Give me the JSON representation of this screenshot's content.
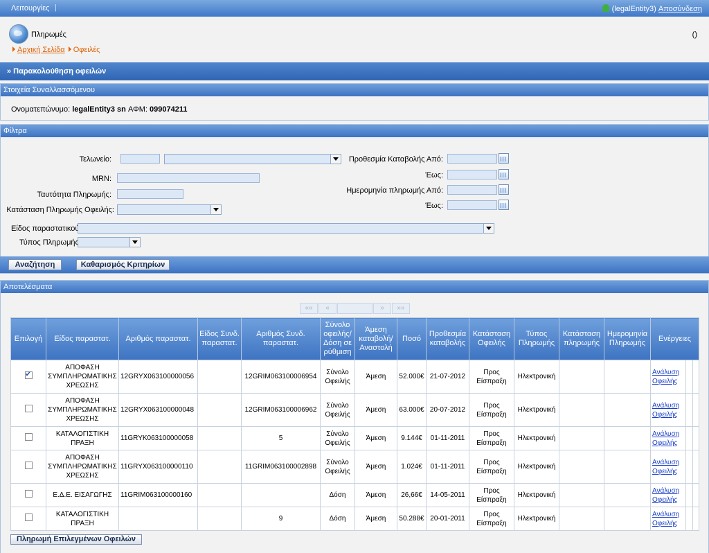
{
  "topbar": {
    "menu": "Λειτουργίες",
    "separator": "|",
    "user": "(legalEntity3)",
    "logout": "Αποσύνδεση"
  },
  "header": {
    "title": "Πληρωμές",
    "right_text": "()",
    "breadcrumb": {
      "home": "Αρχική Σελίδα",
      "current": "Οφειλές"
    }
  },
  "page_bar": "» Παρακολούθηση οφειλών",
  "party": {
    "title": "Στοιχεία Συναλλασσόμενου",
    "name_label": "Ονοματεπώνυμο:",
    "name_value": "legalEntity3 sn",
    "afm_label": "ΑΦΜ:",
    "afm_value": "099074211"
  },
  "filters": {
    "title": "Φίλτρα",
    "customs_office": "Τελωνείο:",
    "mrn": "MRN:",
    "payment_id": "Ταυτότητα Πληρωμής:",
    "debt_payment_status": "Κατάσταση Πληρωμής Οφειλής:",
    "due_from": "Προθεσμία Καταβολής Από:",
    "due_to": "Έως:",
    "paydate_from": "Ημερομηνία πληρωμής Από:",
    "paydate_to": "Έως:",
    "doc_type": "Είδος παραστατικού:",
    "payment_type": "Τύπος Πληρωμής:",
    "search_button": "Αναζήτηση",
    "clear_button": "Καθαρισμός Κριτηρίων"
  },
  "results": {
    "title": "Αποτελέσματα",
    "pager": [
      "««",
      "«",
      "",
      "»",
      "»»"
    ],
    "columns": [
      "Επιλογή",
      "Είδος παραστατ.",
      "Αριθμός παραστατ.",
      "Είδος Συνδ. παραστατ.",
      "Αριθμός Συνδ. παραστατ.",
      "Σύνολο οφειλής/ Δόση σε ρύθμιση",
      "Άμεση καταβολή/ Αναστολή",
      "Ποσό",
      "Προθεσμία καταβολής",
      "Κατάσταση Οφειλής",
      "Τύπος Πληρωμής",
      "Κατάσταση πληρωμής",
      "Ημερομηνία Πληρωμής",
      "Ενέργειες"
    ],
    "rows": [
      {
        "checked": true,
        "doc_type": "ΑΠΟΦΑΣΗ ΣΥΜΠΛΗΡΩΜΑΤΙΚΗΣ ΧΡΕΩΣΗΣ",
        "doc_no": "12GRYX063100000056",
        "rel_type": "",
        "rel_no": "12GRIM063100006954",
        "total": "Σύνολο Οφειλής",
        "immediate": "Άμεση",
        "amount": "52.000€",
        "due": "21-07-2012",
        "debt_status": "Προς Είσπραξη",
        "pay_type": "Ηλεκτρονική",
        "pay_status": "",
        "pay_date": "",
        "action": "Ανάλυση Οφειλής"
      },
      {
        "checked": false,
        "doc_type": "ΑΠΟΦΑΣΗ ΣΥΜΠΛΗΡΩΜΑΤΙΚΗΣ ΧΡΕΩΣΗΣ",
        "doc_no": "12GRYX063100000048",
        "rel_type": "",
        "rel_no": "12GRIM063100006962",
        "total": "Σύνολο Οφειλής",
        "immediate": "Άμεση",
        "amount": "63.000€",
        "due": "20-07-2012",
        "debt_status": "Προς Είσπραξη",
        "pay_type": "Ηλεκτρονική",
        "pay_status": "",
        "pay_date": "",
        "action": "Ανάλυση Οφειλής"
      },
      {
        "checked": false,
        "doc_type": "ΚΑΤΑΛΟΓΙΣΤΙΚΗ ΠΡΑΞΗ",
        "doc_no": "11GRYK063100000058",
        "rel_type": "",
        "rel_no": "5",
        "total": "Σύνολο Οφειλής",
        "immediate": "Άμεση",
        "amount": "9.144€",
        "due": "01-11-2011",
        "debt_status": "Προς Είσπραξη",
        "pay_type": "Ηλεκτρονική",
        "pay_status": "",
        "pay_date": "",
        "action": "Ανάλυση Οφειλής"
      },
      {
        "checked": false,
        "doc_type": "ΑΠΟΦΑΣΗ ΣΥΜΠΛΗΡΩΜΑΤΙΚΗΣ ΧΡΕΩΣΗΣ",
        "doc_no": "11GRYX063100000110",
        "rel_type": "",
        "rel_no": "11GRIM063100002898",
        "total": "Σύνολο Οφειλής",
        "immediate": "Άμεση",
        "amount": "1.024€",
        "due": "01-11-2011",
        "debt_status": "Προς Είσπραξη",
        "pay_type": "Ηλεκτρονική",
        "pay_status": "",
        "pay_date": "",
        "action": "Ανάλυση Οφειλής"
      },
      {
        "checked": false,
        "doc_type": "Ε.Δ.Ε. ΕΙΣΑΓΩΓΗΣ",
        "doc_no": "11GRIM063100000160",
        "rel_type": "",
        "rel_no": "",
        "total": "Δόση",
        "immediate": "Άμεση",
        "amount": "26,66€",
        "due": "14-05-2011",
        "debt_status": "Προς Είσπραξη",
        "pay_type": "Ηλεκτρονική",
        "pay_status": "",
        "pay_date": "",
        "action": "Ανάλυση Οφειλής"
      },
      {
        "checked": false,
        "doc_type": "ΚΑΤΑΛΟΓΙΣΤΙΚΗ ΠΡΑΞΗ",
        "doc_no": "",
        "rel_type": "",
        "rel_no": "9",
        "total": "Δόση",
        "immediate": "Άμεση",
        "amount": "50.288€",
        "due": "20-01-2011",
        "debt_status": "Προς Είσπραξη",
        "pay_type": "Ηλεκτρονική",
        "pay_status": "",
        "pay_date": "",
        "action": "Ανάλυση Οφειλής"
      }
    ],
    "pay_selected_button": "Πληρωμή Επιλεγμένων Οφειλών"
  }
}
